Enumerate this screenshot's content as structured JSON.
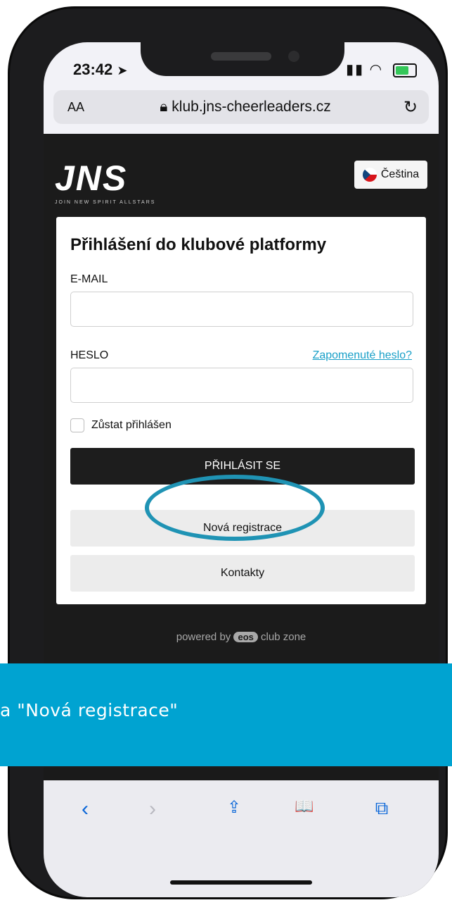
{
  "status": {
    "time": "23:42",
    "location_arrow": "➤"
  },
  "browser": {
    "text_size_label": "AA",
    "url": "klub.jns-cheerleaders.cz",
    "lock_icon": "lock-icon",
    "reload_icon": "reload-icon"
  },
  "site": {
    "logo_text": "JNS",
    "logo_tagline": "JOIN NEW SPIRIT ALLSTARS",
    "language_label": "Čeština"
  },
  "login": {
    "title": "Přihlášení do klubové platformy",
    "email_label": "E-MAIL",
    "email_value": "",
    "password_label": "HESLO",
    "password_value": "",
    "forgot_link": "Zapomenuté heslo?",
    "remember_label": "Zůstat přihlášen",
    "submit_label": "PŘIHLÁSIT SE",
    "register_label": "Nová registrace",
    "contacts_label": "Kontakty"
  },
  "footer": {
    "powered_prefix": "powered by",
    "eos_badge": "eos",
    "powered_suffix": "club zone"
  },
  "toolbar": {
    "back_glyph": "‹",
    "forward_glyph": "›",
    "share_glyph": "⇪",
    "bookmarks_glyph": "📖",
    "tabs_glyph": "⧉"
  },
  "banner": {
    "text": "a  \"Nová registrace\""
  },
  "colors": {
    "accent": "#00a3d1",
    "link": "#1aa0c8",
    "highlight_ring": "#1f93b4",
    "primary_button": "#1d1d1d"
  }
}
